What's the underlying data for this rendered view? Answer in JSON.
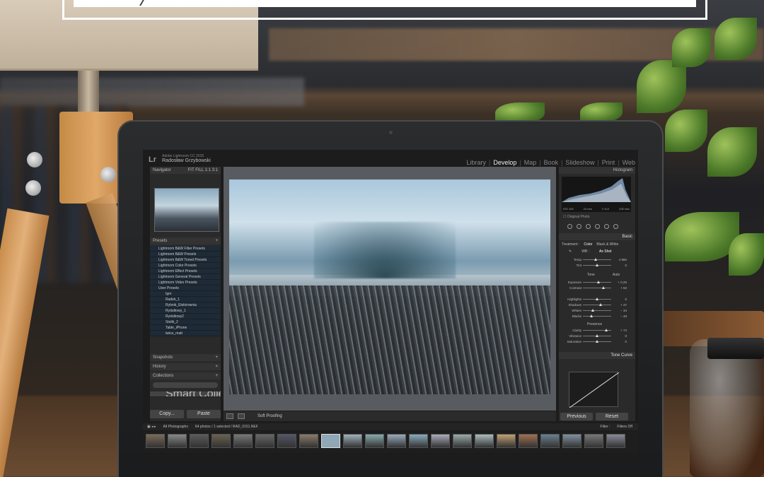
{
  "app": {
    "logo": "Lr",
    "version": "Adobe Lightroom CC 2015",
    "user": "Radosław Grzybowski"
  },
  "modules": [
    "Library",
    "Develop",
    "Map",
    "Book",
    "Slideshow",
    "Print",
    "Web"
  ],
  "active_module": "Develop",
  "left_panel": {
    "navigator": "Navigator",
    "zoom_options": "FIT  FILL  1:1  3:1",
    "presets": "Presets",
    "preset_items": [
      "Lightroom B&W Filter Presets",
      "Lightroom B&W Presets",
      "Lightroom B&W Toned Presets",
      "Lightroom Color Presets",
      "Lightroom Effect Presets",
      "Lightroom General Presets",
      "Lightroom Video Presets",
      "User Presets"
    ],
    "user_presets": [
      "Igor",
      "Radek_1",
      "Rybnik_Elektrownia",
      "Rydultowy_1",
      "Rydultowy2",
      "Stolik_2",
      "Table_iPhone",
      "twice_matt"
    ],
    "snapshots": "Snapshots",
    "history": "History",
    "collections": "Collections",
    "smart_collections": "Smart Collections",
    "copy_label": "Copy...",
    "paste_label": "Paste"
  },
  "toolbar": {
    "soft_proofing": "Soft Proofing"
  },
  "right_panel": {
    "histogram": "Histogram",
    "exif": [
      "ISO 100",
      "24 mm",
      "f / 8.0",
      "1/30 sec"
    ],
    "original_photo": "Original Photo",
    "basic": "Basic",
    "treatment": "Treatment :",
    "treatment_options": [
      "Color",
      "Black & White"
    ],
    "wb": "WB :",
    "wb_value": "As Shot",
    "tone": "Tone",
    "tone_auto": "Auto",
    "presence": "Presence",
    "sliders": [
      {
        "label": "Temp",
        "value": "4 850",
        "level": 0.45
      },
      {
        "label": "Tint",
        "value": "0",
        "level": 0.5
      },
      {
        "label": "Exposure",
        "value": "+ 0,25",
        "level": 0.55
      },
      {
        "label": "Contrast",
        "value": "+ 63",
        "level": 0.72
      },
      {
        "label": "Highlights",
        "value": "0",
        "level": 0.5
      },
      {
        "label": "Shadows",
        "value": "+ 27",
        "level": 0.62
      },
      {
        "label": "Whites",
        "value": "− 34",
        "level": 0.35
      },
      {
        "label": "Blacks",
        "value": "− 48",
        "level": 0.3
      },
      {
        "label": "Clarity",
        "value": "+ 74",
        "level": 0.82
      },
      {
        "label": "Vibrance",
        "value": "0",
        "level": 0.5
      },
      {
        "label": "Saturation",
        "value": "0",
        "level": 0.5
      }
    ],
    "tone_curve": "Tone Curve",
    "previous_label": "Previous",
    "reset_label": "Reset"
  },
  "filmstrip": {
    "source": "All Photographs",
    "count": "64 photos / 1 selected / RAD_0151.NEF",
    "filter_label": "Filter :",
    "filter_value": "Filters Off"
  },
  "colors": {
    "accent": "#1e2a36",
    "panel": "#2a2a2a"
  }
}
